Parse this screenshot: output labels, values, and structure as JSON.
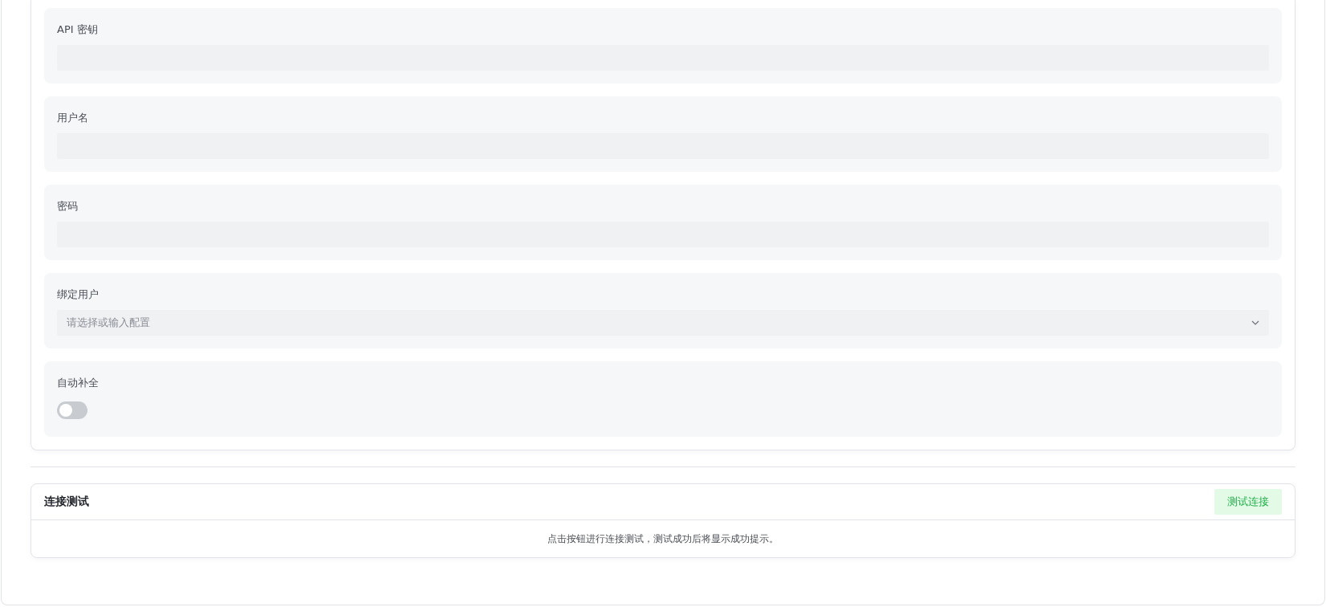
{
  "config_fields": [
    {
      "kind": "text",
      "label": "API 密钥"
    },
    {
      "kind": "text",
      "label": "用户名"
    },
    {
      "kind": "text",
      "label": "密码"
    },
    {
      "kind": "select",
      "label": "绑定用户",
      "placeholder": "请选择或输入配置"
    },
    {
      "kind": "switch",
      "label": "自动补全",
      "on": false
    }
  ],
  "connection_test": {
    "title": "连接测试",
    "button": "测试连接",
    "message": "点击按钮进行连接测试，测试成功后将显示成功提示。"
  }
}
